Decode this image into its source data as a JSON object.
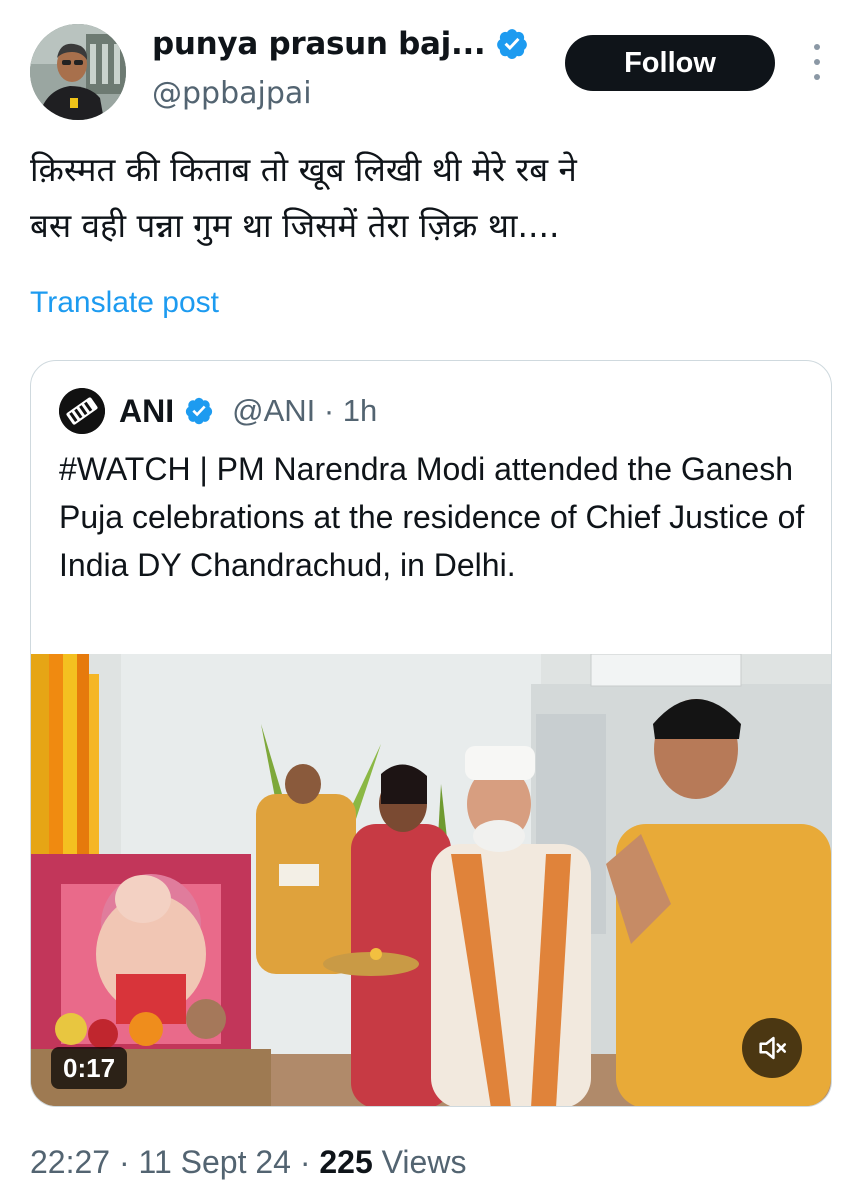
{
  "author": {
    "display_name": "punya prasun baj...",
    "handle": "@ppbajpai",
    "verified_icon": "verified-badge-icon",
    "avatar_icon": "profile-photo"
  },
  "actions": {
    "follow_label": "Follow",
    "more_icon": "more-options-icon"
  },
  "post": {
    "lines": [
      "क़िस्मत की किताब तो खूब लिखी थी मेरे रब ने",
      "बस वही पन्ना गुम था जिसमें तेरा ज़िक्र था...."
    ],
    "translate_label": "Translate post"
  },
  "quoted_post": {
    "display_name": "ANI",
    "handle_time": "@ANI · 1h",
    "text": "#WATCH | PM Narendra Modi attended the Ganesh Puja celebrations at the residence of Chief Justice of India DY Chandrachud, in Delhi.",
    "video": {
      "duration": "0:17",
      "mute_icon": "speaker-muted-icon"
    }
  },
  "meta": {
    "time_date": "22:27 · 11 Sept 24 · ",
    "views_count": "225",
    "views_label": " Views"
  },
  "colors": {
    "accent": "#1d9bf0",
    "text_primary": "#0f1419",
    "text_secondary": "#536471",
    "border": "#cfd9de",
    "button_bg": "#0f1419"
  }
}
